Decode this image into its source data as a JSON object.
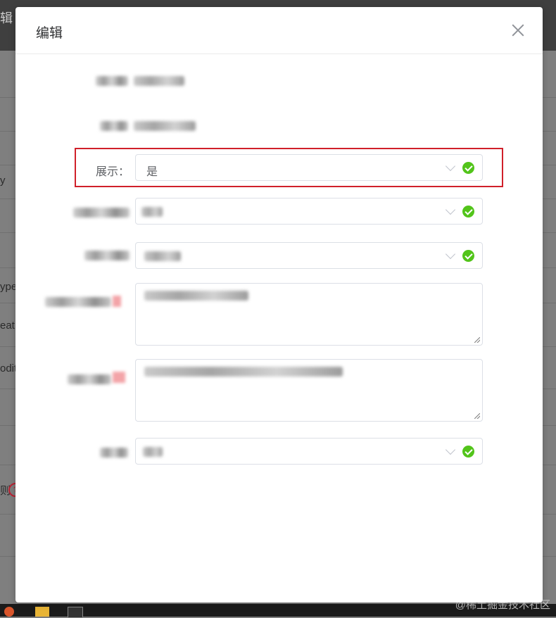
{
  "background": {
    "title_fragment": "辑",
    "left_fragments": [
      "y",
      "ype",
      "eat",
      "odit",
      "则"
    ],
    "help_symbol": "?"
  },
  "dialog": {
    "title": "编辑",
    "close_icon": "close-icon",
    "fields": [
      {
        "type": "static-blurred"
      },
      {
        "type": "static-blurred"
      },
      {
        "type": "select",
        "label": "展示：",
        "value": "是",
        "status": "valid"
      },
      {
        "type": "select-blurred",
        "status": "valid"
      },
      {
        "type": "select-blurred",
        "status": "valid"
      },
      {
        "type": "textarea-blurred"
      },
      {
        "type": "textarea-blurred"
      },
      {
        "type": "select-blurred",
        "status": "valid"
      }
    ],
    "highlight_color": "#d0202a",
    "valid_color": "#52c41a"
  },
  "watermark": "@稀土掘金技术社区"
}
